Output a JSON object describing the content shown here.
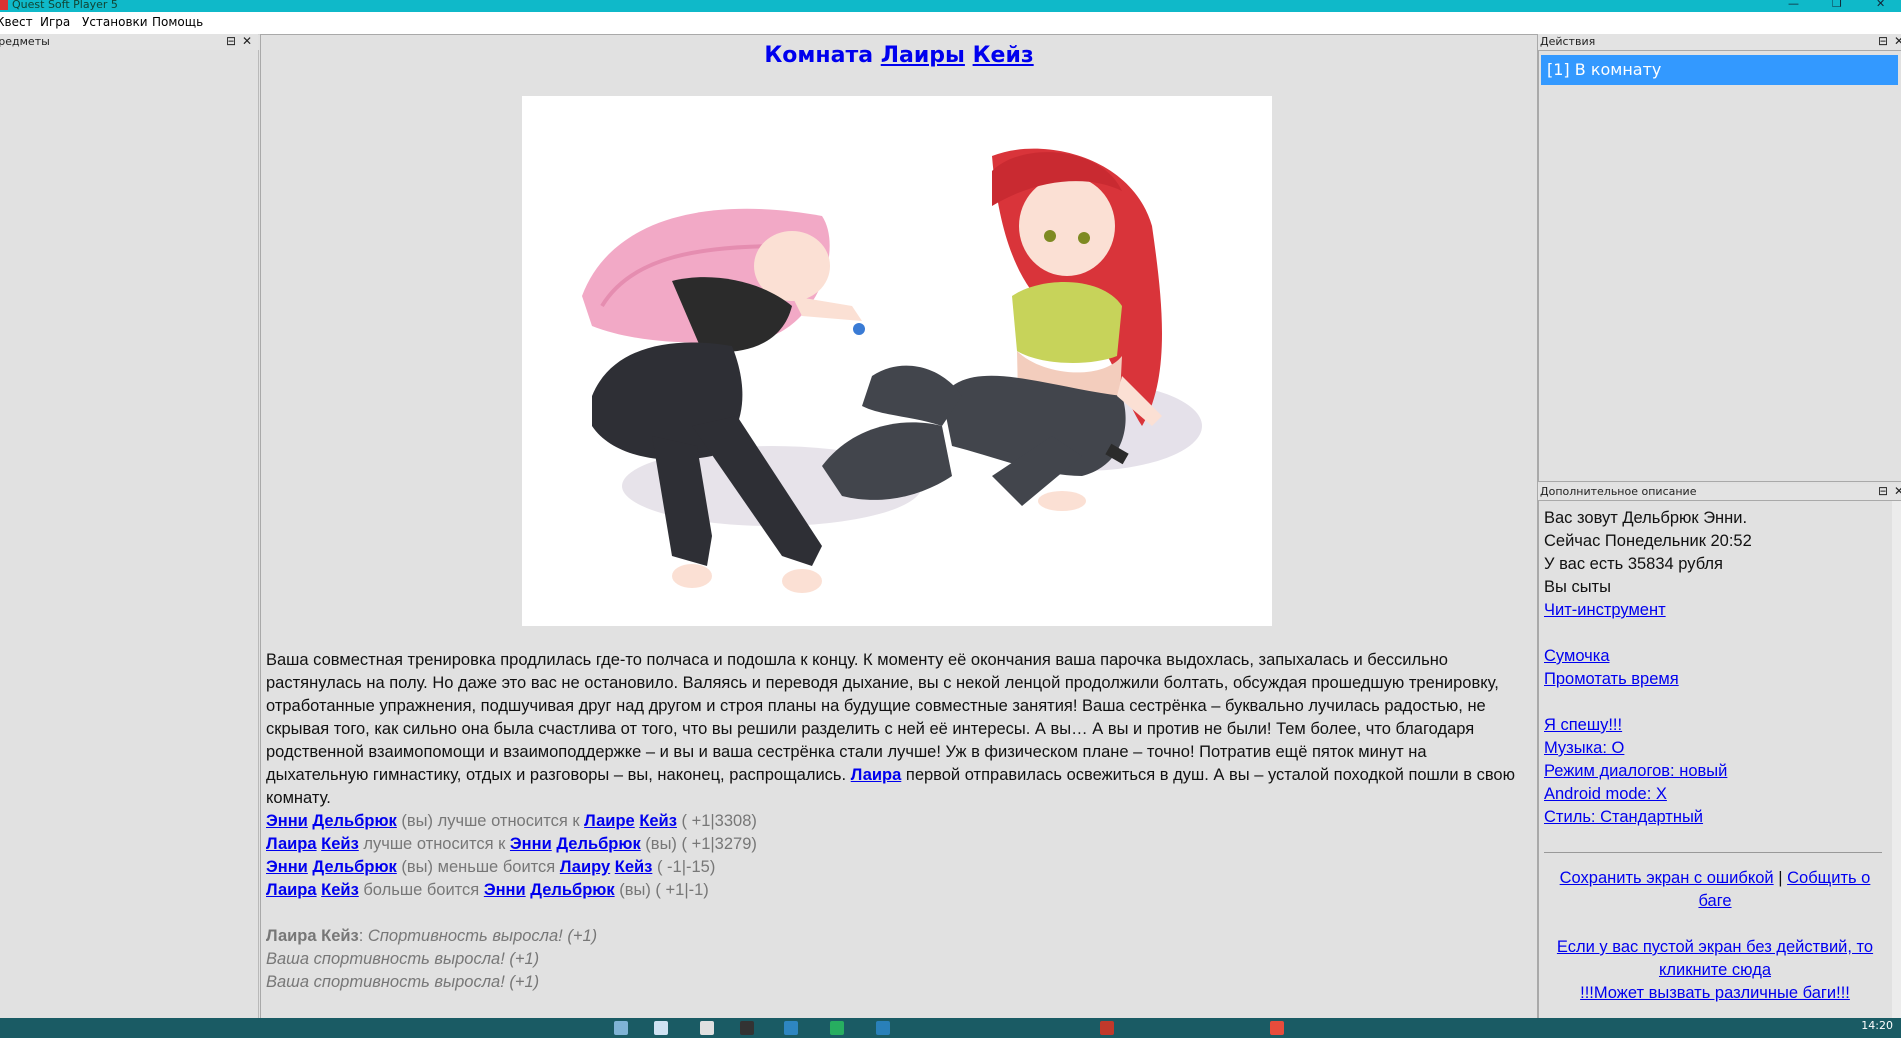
{
  "window": {
    "title": "Quest Soft Player 5"
  },
  "menu": [
    "Квест",
    "Игра",
    "Установки",
    "Помощь"
  ],
  "panels": {
    "items_title": "Предметы",
    "actions_title": "Действия",
    "desc_title": "Дополнительное описание"
  },
  "room": {
    "title_prefix": "Комната",
    "title_link1": "Лаиры",
    "title_link2": "Кейз",
    "paragraph": {
      "p1": "Ваша совместная тренировка продлилась где-то полчаса и подошла к концу. К моменту её окончания ваша парочка выдохлась, запыхалась и бессильно растянулась на полу. Но даже это вас не остановило. Валяясь и переводя дыхание, вы с некой ленцой продолжили болтать, обсуждая прошедшую тренировку, отработанные упражнения, подшучивая друг над другом и строя планы на будущие совместные занятия! Ваша сестрёнка – буквально лучилась радостью, не скрывая того, как сильно она была счастлива от того, что вы решили разделить с ней её интересы. А вы… А вы и против не были! Тем более, что благодаря родственной взаимопомощи и взаимоподдержке – и вы и ваша сестрёнка стали лучше! Уж в физическом плане – точно! Потратив ещё пяток минут на дыхательную гимнастику, отдых и разговоры – вы, наконец, распрощались.",
      "link": "Лаира",
      "p2": "первой отправилась освежиться в душ. А вы – усталой походкой пошли в свою комнату."
    },
    "relations": [
      {
        "a1": "Энни",
        "a2": "Дельбрюк",
        "mid": " (вы) лучше относится к ",
        "b1": "Лаире",
        "b2": "Кейз",
        "tail": " ( +1|3308)"
      },
      {
        "a1": "Лаира",
        "a2": "Кейз",
        "mid": " лучше относится к ",
        "b1": "Энни",
        "b2": "Дельбрюк",
        "tail": " (вы) ( +1|3279)"
      },
      {
        "a1": "Энни",
        "a2": "Дельбрюк",
        "mid": " (вы) меньше боится ",
        "b1": "Лаиру",
        "b2": "Кейз",
        "tail": " ( -1|-15)"
      },
      {
        "a1": "Лаира",
        "a2": "Кейз",
        "mid": " больше боится ",
        "b1": "Энни",
        "b2": "Дельбрюк",
        "tail": " (вы) ( +1|-1)"
      }
    ],
    "stat1_name": "Лаира Кейз",
    "stat1_text": "Спортивность выросла! (+1)",
    "stat2": "Ваша спортивность выросла! (+1)",
    "stat3": "Ваша спортивность выросла! (+1)"
  },
  "actions": [
    "[1] В комнату"
  ],
  "desc": {
    "line1": "Вас зовут Дельбрюк Энни.",
    "line2": "Сейчас Понедельник 20:52",
    "line3": "У вас есть 35834 рубля",
    "line4": "Вы сыты",
    "cheat": "Чит-инструмент",
    "bag": "Сумочка",
    "skip": "Промотать время",
    "hurry": "Я спешу!!!",
    "music": "Музыка: О",
    "dialog": "Режим диалогов: новый",
    "android": "Android mode: X",
    "style": "Стиль: Стандартный",
    "save_error": "Сохранить экран с ошибкой",
    "sep": "|",
    "report": "Собщить о баге",
    "empty_screen": "Если у вас пустой экран без действий, то кликните сюда",
    "may_cause": "!!!Может вызвать различные баги!!!"
  },
  "taskbar": {
    "clock": "14:20"
  }
}
